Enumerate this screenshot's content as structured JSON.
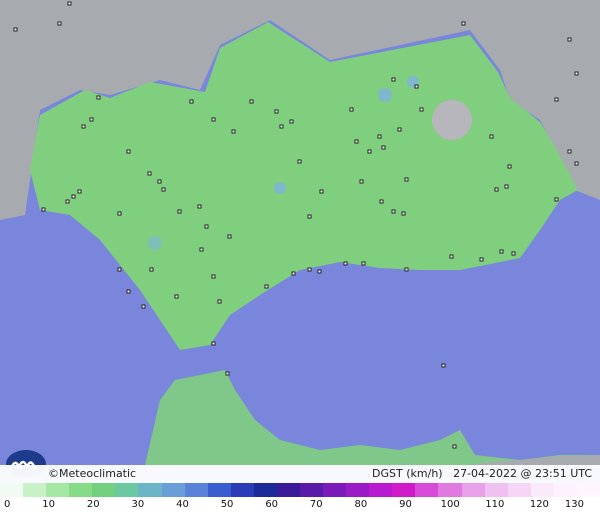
{
  "map": {
    "sea_color": "#7a86db",
    "land_color": "#9fa4aa",
    "region_color": "#7fcf7f",
    "gust_low_color": "#8fd98f",
    "gust_mid_color": "#78b8e8",
    "station_marker_color": "#222222"
  },
  "footer": {
    "brand": "©Meteoclimatic",
    "product": "DGST (km/h)   27-04-2022 @ 23:51 UTC"
  },
  "scale": {
    "ticks": [
      "0",
      "10",
      "20",
      "30",
      "40",
      "50",
      "60",
      "70",
      "80",
      "90",
      "100",
      "110",
      "120",
      "130"
    ],
    "colors": [
      "#f2fbf2",
      "#c8f1c8",
      "#a4e8a4",
      "#86dc86",
      "#73d07e",
      "#6cc8a0",
      "#6cb4c8",
      "#6a9ed8",
      "#5a82d8",
      "#3a5ed0",
      "#2a3cb8",
      "#1a2a98",
      "#3a1a98",
      "#5a1aa8",
      "#7a1ab8",
      "#9a1ac8",
      "#b81ad0",
      "#d01ac8",
      "#d84ad8",
      "#e07ae0",
      "#e8a0e8",
      "#f0c0f0",
      "#f6d6f6",
      "#faeafa",
      "#fdf2fd",
      "#fff6ff"
    ]
  }
}
